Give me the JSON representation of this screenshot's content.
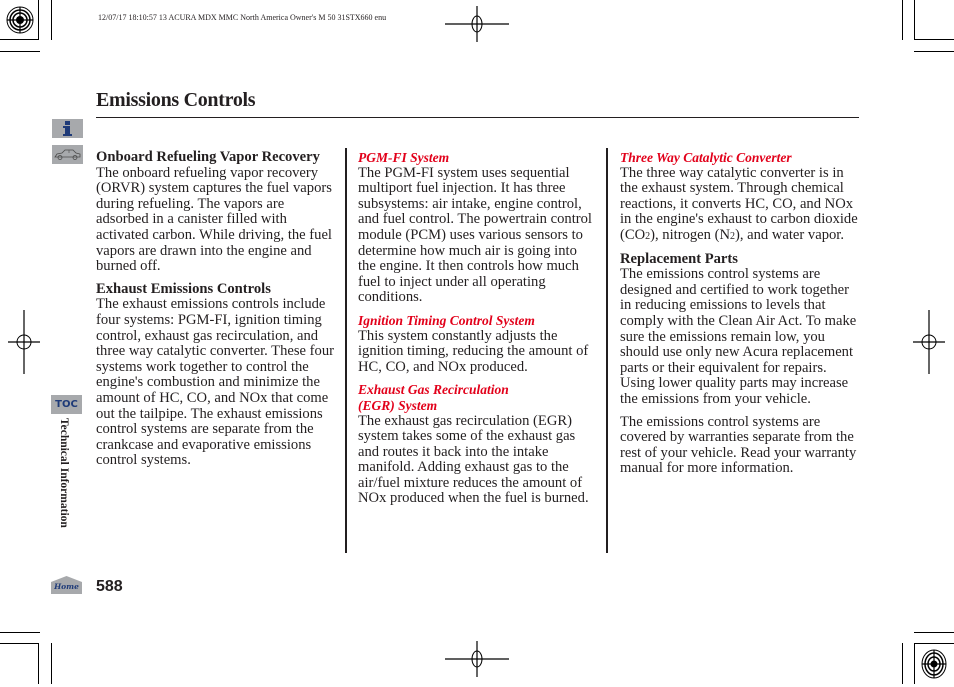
{
  "print_header": "12/07/17 18:10:57    13 ACURA MDX MMC North America Owner's M 50 31STX660 enu",
  "page": {
    "title": "Emissions Controls",
    "page_number": "588",
    "section_label": "Technical Information",
    "toc_label": "TOC",
    "home_label": "Home"
  },
  "icons": {
    "info": "info-icon",
    "car": "car-icon",
    "toc": "toc-icon",
    "home": "home-icon"
  },
  "colors": {
    "heading_red": "#e2001a",
    "tab_gray": "#a7a9ac",
    "icon_blue": "#1e3a78",
    "text": "#231f20"
  },
  "columns": [
    {
      "sections": [
        {
          "heading": "Onboard Refueling Vapor Recovery",
          "style": "bold",
          "paragraphs": [
            "The onboard refueling vapor recovery (ORVR) system captures the fuel vapors during refueling. The vapors are adsorbed in a canister filled with activated carbon. While driving, the fuel vapors are drawn into the engine and burned off."
          ]
        },
        {
          "heading": "Exhaust Emissions Controls",
          "style": "bold",
          "paragraphs": [
            "The exhaust emissions controls include four systems: PGM-FI, ignition timing control, exhaust gas recirculation, and three way catalytic converter. These four systems work together to control the engine's combustion and minimize the amount of HC, CO, and NOx that come out the tailpipe. The exhaust emissions control systems are separate from the crankcase and evaporative emissions control systems."
          ]
        }
      ]
    },
    {
      "sections": [
        {
          "heading": "PGM-FI System",
          "style": "red",
          "paragraphs": [
            "The PGM-FI system uses sequential multiport fuel injection. It has three subsystems: air intake, engine control, and fuel control. The powertrain control module (PCM) uses various sensors to determine how much air is going into the engine. It then controls how much fuel to inject under all operating conditions."
          ]
        },
        {
          "heading": "Ignition Timing Control System",
          "style": "red",
          "paragraphs": [
            "This system constantly adjusts the ignition timing, reducing the amount of HC, CO, and NOx produced."
          ]
        },
        {
          "heading": "Exhaust Gas Recirculation (EGR) System",
          "style": "red",
          "paragraphs": [
            "The exhaust gas recirculation (EGR) system takes some of the exhaust gas and routes it back into the intake manifold. Adding exhaust gas to the air/fuel mixture reduces the amount of NOx produced when the fuel is burned."
          ]
        }
      ]
    },
    {
      "sections": [
        {
          "heading": "Three Way Catalytic Converter",
          "style": "red",
          "paragraphs": [
            "The three way catalytic converter is in the exhaust system. Through chemical reactions, it converts HC, CO, and NOx in the engine's exhaust to carbon dioxide (CO2), nitrogen (N2), and water vapor."
          ]
        },
        {
          "heading": "Replacement Parts",
          "style": "bold",
          "paragraphs": [
            "The emissions control systems are designed and certified to work together in reducing emissions to levels that comply with the Clean Air Act. To make sure the emissions remain low, you should use only new Acura replacement parts or their equivalent for repairs. Using lower quality parts may increase the emissions from your vehicle.",
            "The emissions control systems are covered by warranties separate from the rest of your vehicle. Read your warranty manual for more information."
          ]
        }
      ]
    }
  ]
}
